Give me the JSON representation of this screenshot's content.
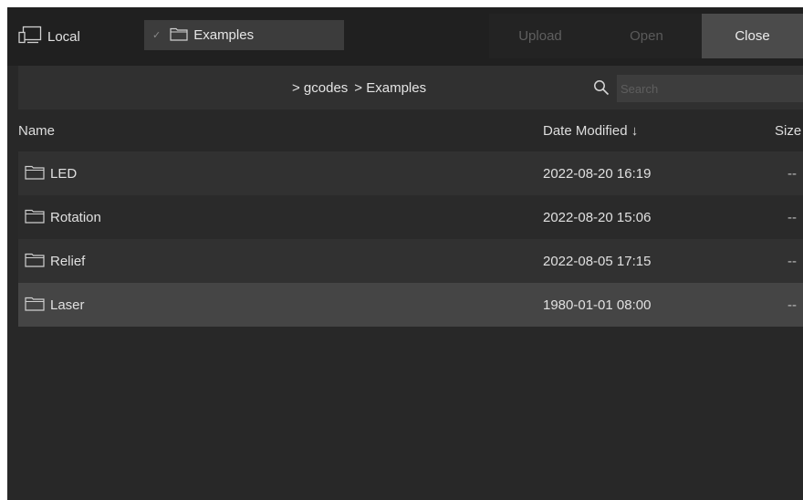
{
  "toolbar": {
    "source_label": "Local",
    "folder_label": "Examples",
    "upload_label": "Upload",
    "open_label": "Open",
    "close_label": "Close"
  },
  "path": {
    "segments": [
      "> gcodes",
      "> Examples"
    ],
    "search_placeholder": "Search"
  },
  "columns": {
    "name": "Name",
    "date": "Date Modified ↓",
    "size": "Size"
  },
  "files": [
    {
      "name": "LED",
      "date": "2022-08-20 16:19",
      "size": "--"
    },
    {
      "name": "Rotation",
      "date": "2022-08-20 15:06",
      "size": "--"
    },
    {
      "name": "Relief",
      "date": "2022-08-05 17:15",
      "size": "--"
    },
    {
      "name": "Laser",
      "date": "1980-01-01 08:00",
      "size": "--"
    }
  ],
  "icons": {
    "source": "computer-icon",
    "folder": "folder-icon",
    "search": "search-icon",
    "dropdown": "chevron-down-icon"
  },
  "colors": {
    "background": "#282828",
    "toolbar": "#202020",
    "selected_row": "#454545",
    "close_button": "#4b4b4b"
  }
}
